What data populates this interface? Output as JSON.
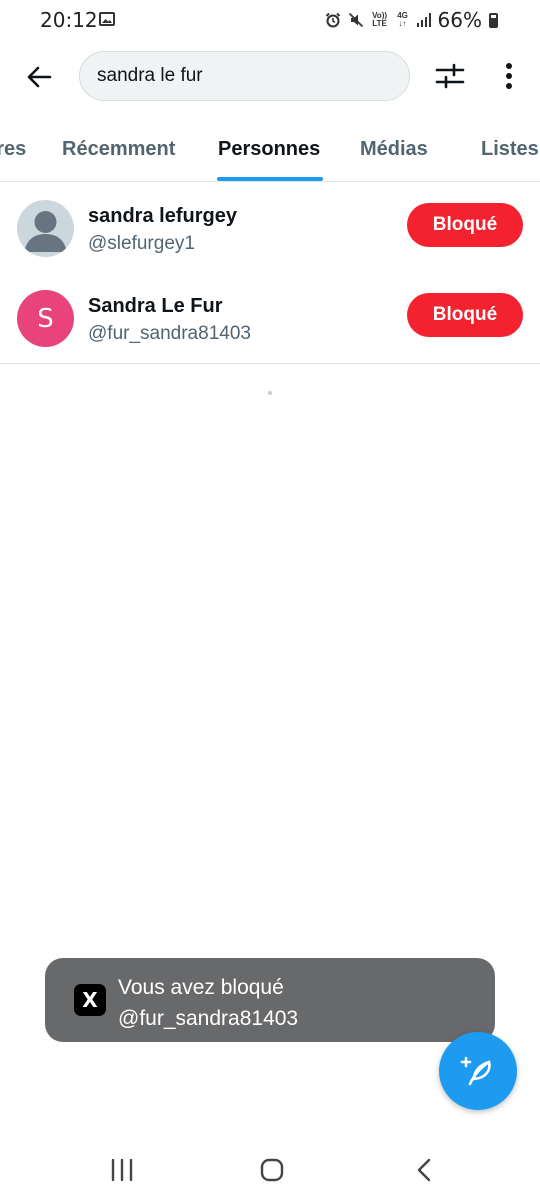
{
  "status_bar": {
    "time": "20:12",
    "volte_label": "Vo)) LTE",
    "network_label": "4G",
    "battery_percent": "66%"
  },
  "header": {
    "search_value": "sandra le fur"
  },
  "tabs": [
    {
      "label": "Populaires"
    },
    {
      "label": "Récemment"
    },
    {
      "label": "Personnes",
      "active": true
    },
    {
      "label": "Médias"
    },
    {
      "label": "Listes"
    }
  ],
  "users": [
    {
      "name": "sandra lefurgey",
      "handle": "@slefurgey1",
      "avatar_letter": "",
      "action_label": "Bloqué"
    },
    {
      "name": "Sandra Le Fur",
      "handle": "@fur_sandra81403",
      "avatar_letter": "S",
      "action_label": "Bloqué"
    }
  ],
  "toast": {
    "logo": "X",
    "line1": "Vous avez bloqué",
    "line2": "@fur_sandra81403"
  },
  "colors": {
    "accent": "#1d9bf0",
    "blocked": "#f4212e",
    "avatar_pink": "#e8437a",
    "toast_bg": "#68696b"
  },
  "icons": {
    "back": "arrow-left-icon",
    "filter": "sliders-icon",
    "more": "more-vertical-icon",
    "fab": "compose-feather-icon",
    "nav_recents": "recents-icon",
    "nav_home": "home-icon",
    "nav_back": "back-chevron-icon"
  }
}
